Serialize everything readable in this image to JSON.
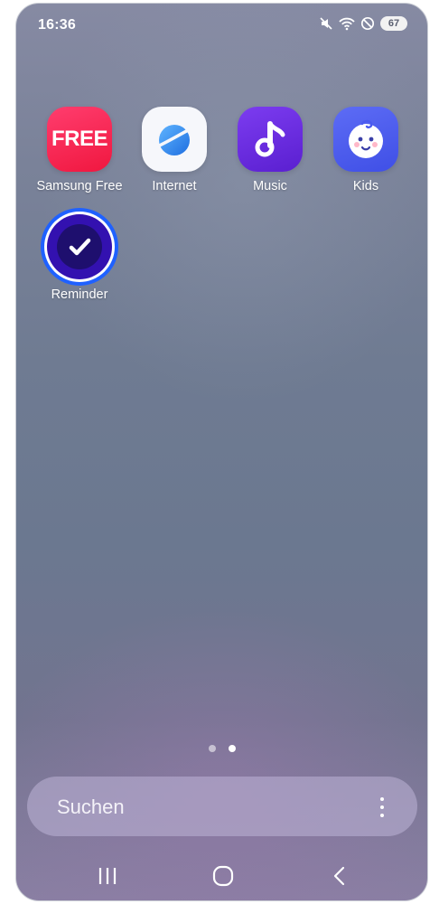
{
  "status_bar": {
    "time": "16:36",
    "icons": [
      "mute-icon",
      "wifi-icon",
      "do-not-disturb-icon"
    ],
    "battery": "67"
  },
  "apps": [
    {
      "label": "Samsung Free",
      "icon": "samsung-free-icon",
      "icon_text": "FREE",
      "color": "#f0173f"
    },
    {
      "label": "Internet",
      "icon": "internet-icon",
      "color": "#2d8cf0"
    },
    {
      "label": "Music",
      "icon": "music-icon",
      "color": "#6a2de0"
    },
    {
      "label": "Kids",
      "icon": "kids-icon",
      "color": "#4a5af0"
    },
    {
      "label": "Reminder",
      "icon": "reminder-icon",
      "color": "#3311b0",
      "selected": true
    }
  ],
  "page_indicator": {
    "count": 2,
    "active_index": 1
  },
  "search": {
    "placeholder": "Suchen"
  },
  "nav": [
    "recents-icon",
    "home-icon",
    "back-icon"
  ]
}
